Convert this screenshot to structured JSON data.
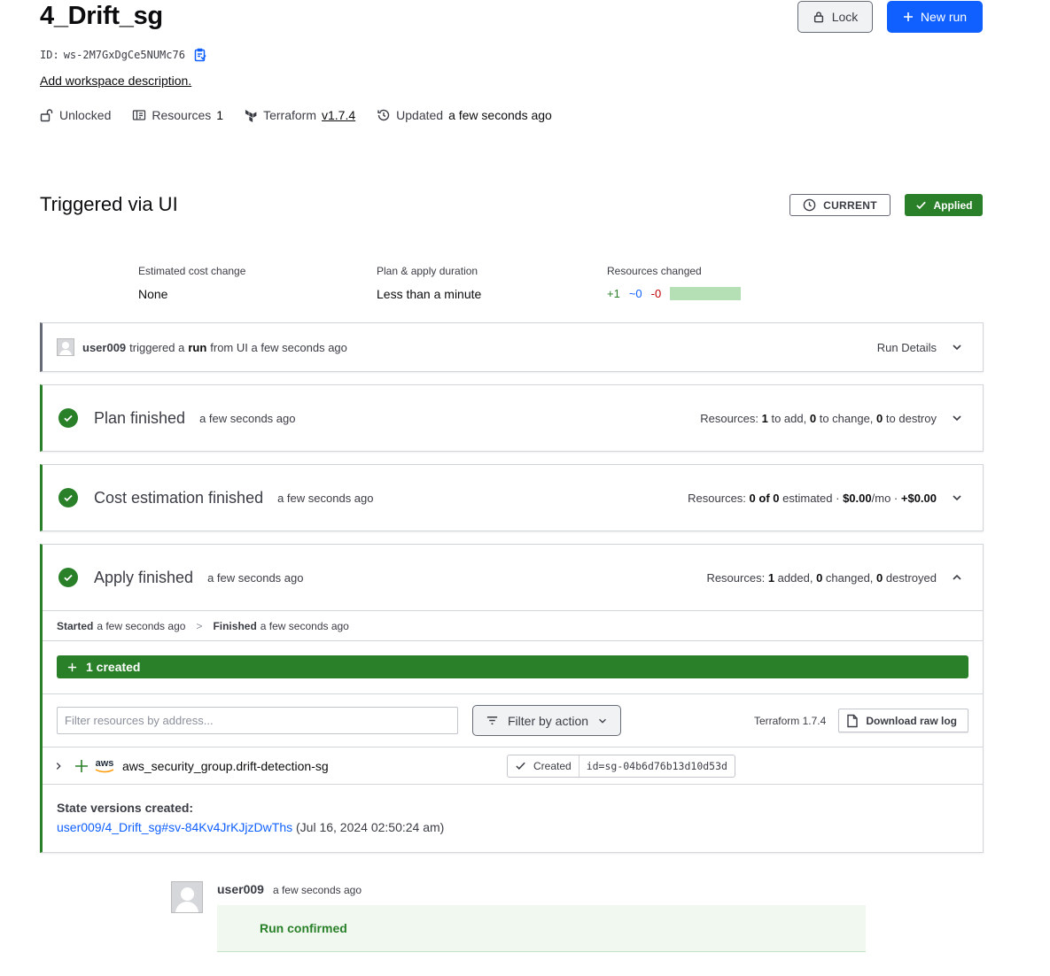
{
  "workspace": {
    "title": "4_Drift_sg",
    "id_label": "ID:",
    "id_value": "ws-2M7GxDgCe5NUMc76",
    "add_description": "Add workspace description.",
    "lock_label": "Lock",
    "new_run_label": "New run",
    "meta": {
      "lock_state": "Unlocked",
      "resources_label": "Resources",
      "resources_count": "1",
      "terraform_label": "Terraform",
      "terraform_version": "v1.7.4",
      "updated_label": "Updated",
      "updated_value": "a few seconds ago"
    }
  },
  "run": {
    "title": "Triggered via UI",
    "current_badge": "CURRENT",
    "applied_badge": "Applied",
    "stats": {
      "cost_label": "Estimated cost change",
      "cost_value": "None",
      "duration_label": "Plan & apply duration",
      "duration_value": "Less than a minute",
      "changed_label": "Resources changed",
      "add": "+1",
      "change": "~0",
      "destroy": "-0"
    },
    "trigger": {
      "user": "user009",
      "text_1": "triggered a",
      "text_run": "run",
      "text_2": "from UI a few seconds ago",
      "details_label": "Run Details"
    },
    "plan": {
      "title": "Plan finished",
      "time": "a few seconds ago",
      "res_prefix": "Resources:",
      "add_n": "1",
      "add_t": "to add,",
      "change_n": "0",
      "change_t": "to change,",
      "destroy_n": "0",
      "destroy_t": "to destroy"
    },
    "cost": {
      "title": "Cost estimation finished",
      "time": "a few seconds ago",
      "res_prefix": "Resources:",
      "estimated_b": "0 of 0",
      "estimated_t": "estimated ·",
      "monthly_b": "$0.00",
      "monthly_t": "/mo ·",
      "delta_b": "+$0.00"
    },
    "apply": {
      "title": "Apply finished",
      "time": "a few seconds ago",
      "res_prefix": "Resources:",
      "added_n": "1",
      "added_t": "added,",
      "changed_n": "0",
      "changed_t": "changed,",
      "destroyed_n": "0",
      "destroyed_t": "destroyed",
      "started_label": "Started",
      "started_time": "a few seconds ago",
      "sep": ">",
      "finished_label": "Finished",
      "finished_time": "a few seconds ago",
      "created_bar": "1 created",
      "filter_placeholder": "Filter resources by address...",
      "filter_action_label": "Filter by action",
      "terraform_version": "Terraform 1.7.4",
      "download_label": "Download raw log",
      "resource": {
        "provider": "aws",
        "address": "aws_security_group.drift-detection-sg",
        "status": "Created",
        "id": "id=sg-04b6d76b13d10d53d"
      },
      "state_label": "State versions created:",
      "state_link": "user009/4_Drift_sg#sv-84Kv4JrKJjzDwThs",
      "state_date": "(Jul 16, 2024 02:50:24 am)"
    },
    "comment": {
      "user": "user009",
      "time": "a few seconds ago",
      "message": "Run confirmed"
    }
  },
  "colors": {
    "primary": "#1060ff",
    "success": "#2a8029",
    "add": "#2a8029",
    "change": "#1060ff",
    "destroy": "#c00005"
  }
}
